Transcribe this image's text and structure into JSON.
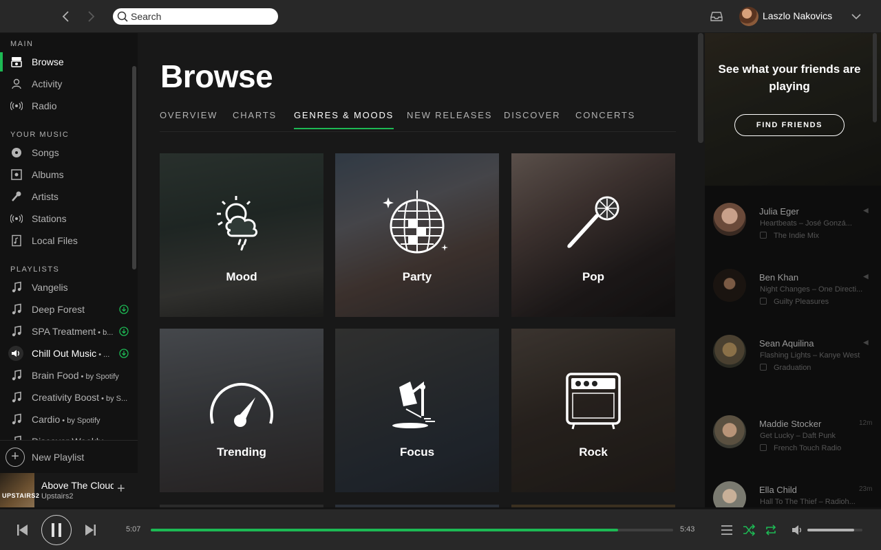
{
  "search": {
    "placeholder": "Search"
  },
  "user": {
    "name": "Laszlo Nakovics"
  },
  "sidebar": {
    "main_heading": "MAIN",
    "main_items": [
      {
        "label": "Browse",
        "icon": "browse-icon"
      },
      {
        "label": "Activity",
        "icon": "activity-icon"
      },
      {
        "label": "Radio",
        "icon": "radio-icon"
      }
    ],
    "your_music_heading": "YOUR MUSIC",
    "your_music_items": [
      {
        "label": "Songs",
        "icon": "songs-icon"
      },
      {
        "label": "Albums",
        "icon": "albums-icon"
      },
      {
        "label": "Artists",
        "icon": "artists-icon"
      },
      {
        "label": "Stations",
        "icon": "stations-icon"
      },
      {
        "label": "Local Files",
        "icon": "local-files-icon"
      }
    ],
    "playlists_heading": "PLAYLISTS",
    "playlists": [
      {
        "label": "Vangelis",
        "by": ""
      },
      {
        "label": "Deep Forest",
        "by": ""
      },
      {
        "label": "SPA Treatment",
        "by": " • b..."
      },
      {
        "label": "Chill Out Music",
        "by": " • ..."
      },
      {
        "label": "Brain Food",
        "by": " • by Spotify"
      },
      {
        "label": "Creativity Boost",
        "by": " • by S..."
      },
      {
        "label": "Cardio",
        "by": " • by Spotify"
      },
      {
        "label": "Discover Weekly",
        "by": " • ..."
      }
    ],
    "new_playlist": "New Playlist"
  },
  "now_playing": {
    "title": "Above The Clouds",
    "artist": "Upstairs2",
    "art_text": "UPSTAIRS2"
  },
  "main": {
    "title": "Browse",
    "tabs": [
      "OVERVIEW",
      "CHARTS",
      "GENRES & MOODS",
      "NEW RELEASES",
      "DISCOVER",
      "CONCERTS"
    ],
    "active_tab": "GENRES & MOODS",
    "tiles": [
      {
        "label": "Mood",
        "icon": "weather-icon"
      },
      {
        "label": "Party",
        "icon": "disco-ball-icon"
      },
      {
        "label": "Pop",
        "icon": "microphone-icon"
      },
      {
        "label": "Trending",
        "icon": "gauge-icon"
      },
      {
        "label": "Focus",
        "icon": "desk-lamp-icon"
      },
      {
        "label": "Rock",
        "icon": "amplifier-icon"
      }
    ]
  },
  "friends": {
    "headline": "See what your friends are playing",
    "find_button": "FIND FRIENDS",
    "list": [
      {
        "name": "Julia Eger",
        "track": "Heartbeats – José Gonzá...",
        "context": "The Indie Mix",
        "time": ""
      },
      {
        "name": "Ben Khan",
        "track": "Night Changes – One Directi...",
        "context": "Guilty Pleasures",
        "time": ""
      },
      {
        "name": "Sean Aquilina",
        "track": "Flashing Lights – Kanye West",
        "context": "Graduation",
        "time": ""
      },
      {
        "name": "Maddie Stocker",
        "track": "Get Lucky – Daft Punk",
        "context": "French Touch Radio",
        "time": "12m"
      },
      {
        "name": "Ella Child",
        "track": "Hall To The Thief – Radioh...",
        "context": "",
        "time": "23m"
      }
    ]
  },
  "player": {
    "elapsed": "5:07",
    "duration": "5:43",
    "progress": 0.895,
    "volume": 0.85
  },
  "colors": {
    "accent": "#1db954",
    "bg": "#181818",
    "sidebar": "#121212",
    "bar": "#282828"
  }
}
